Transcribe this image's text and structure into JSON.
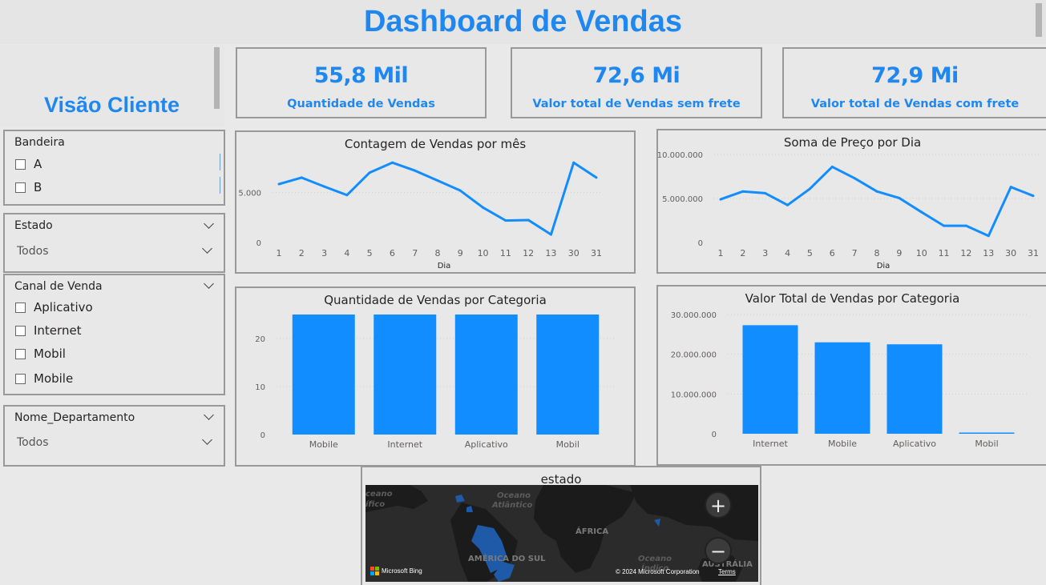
{
  "header": {
    "title": "Dashboard de Vendas"
  },
  "left_panel": {
    "title": "Visão Cliente"
  },
  "kpis": [
    {
      "value": "55,8 Mil",
      "label": "Quantidade de Vendas"
    },
    {
      "value": "72,6 Mi",
      "label": "Valor total de Vendas sem frete"
    },
    {
      "value": "72,9 Mi",
      "label": "Valor total de Vendas com frete"
    }
  ],
  "slicers": {
    "bandeira": {
      "title": "Bandeira",
      "options": [
        "A",
        "B"
      ]
    },
    "estado": {
      "title": "Estado",
      "value": "Todos"
    },
    "canal": {
      "title": "Canal de Venda",
      "options": [
        "Aplicativo",
        "Internet",
        "Mobil",
        "Mobile"
      ]
    },
    "departamento": {
      "title": "Nome_Departamento",
      "value": "Todos"
    }
  },
  "map": {
    "title": "estado",
    "labels": {
      "oceano1": "Oceano",
      "oceano1b": "Atlântico",
      "oceano2": "Oceano",
      "oceano2b": "Índico",
      "oceano3a": "ceano",
      "oceano3b": "ífico",
      "africa": "ÁFRICA",
      "america": "AMÉRICA DO SUL",
      "australia": "AUSTRÁLIA"
    },
    "bing": "Microsoft Bing",
    "copyright": "© 2024 Microsoft Corporation",
    "terms": "Terms",
    "zoom_in": "+",
    "zoom_out": "−"
  },
  "colors": {
    "accent": "#1e88f0",
    "series": "#118dff"
  },
  "chart_data": [
    {
      "type": "line",
      "title": "Contagem de Vendas por mês",
      "xlabel": "Dia",
      "ylabel": "",
      "categories": [
        "1",
        "2",
        "3",
        "4",
        "5",
        "6",
        "7",
        "8",
        "9",
        "10",
        "11",
        "12",
        "13",
        "30",
        "31"
      ],
      "values": [
        5850,
        6500,
        5600,
        4750,
        7000,
        8000,
        7200,
        6200,
        5200,
        3500,
        2200,
        2250,
        800,
        8000,
        6500
      ],
      "ylim": [
        0,
        8900
      ],
      "yticks": [
        0,
        5000
      ],
      "ytick_labels": [
        "0",
        "5.000"
      ]
    },
    {
      "type": "line",
      "title": "Soma de Preço por Dia",
      "xlabel": "Dia",
      "ylabel": "",
      "categories": [
        "1",
        "2",
        "3",
        "4",
        "5",
        "6",
        "7",
        "8",
        "9",
        "10",
        "11",
        "12",
        "13",
        "30",
        "31"
      ],
      "values": [
        4900000,
        5800000,
        5600000,
        4250000,
        6100000,
        8600000,
        7300000,
        5800000,
        5050000,
        3450000,
        1900000,
        1900000,
        750000,
        6300000,
        5300000
      ],
      "ylim": [
        0,
        11000000
      ],
      "yticks": [
        0,
        5000000,
        10000000
      ],
      "ytick_labels": [
        "0",
        "5.000.000",
        "10.000.000"
      ]
    },
    {
      "type": "bar",
      "title": "Quantidade de Vendas por Categoria",
      "xlabel": "",
      "ylabel": "",
      "categories": [
        "Mobile",
        "Internet",
        "Aplicativo",
        "Mobil"
      ],
      "values": [
        25,
        25,
        25,
        25
      ],
      "ylim": [
        0,
        27
      ],
      "yticks": [
        0,
        10,
        20
      ],
      "ytick_labels": [
        "0",
        "10",
        "20"
      ]
    },
    {
      "type": "bar",
      "title": "Valor Total de Vendas por Categoria",
      "xlabel": "",
      "ylabel": "",
      "categories": [
        "Internet",
        "Mobile",
        "Aplicativo",
        "Mobil"
      ],
      "values": [
        27300000,
        23000000,
        22500000,
        300000
      ],
      "ylim": [
        0,
        31000000
      ],
      "yticks": [
        0,
        10000000,
        20000000,
        30000000
      ],
      "ytick_labels": [
        "0",
        "10.000.000",
        "20.000.000",
        "30.000.000"
      ]
    }
  ]
}
